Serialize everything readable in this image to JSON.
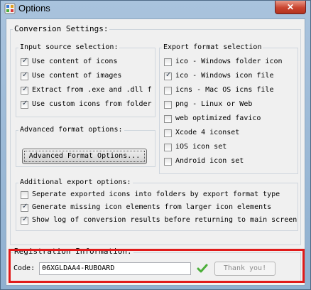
{
  "window": {
    "title": "Options",
    "close_label": "✕"
  },
  "conversion": {
    "title": "Conversion Settings:"
  },
  "input_source": {
    "title": "Input source selection:",
    "items": [
      {
        "label": "Use content of icons",
        "checked": true
      },
      {
        "label": "Use content of images",
        "checked": true
      },
      {
        "label": "Extract from .exe and .dll f",
        "checked": true
      },
      {
        "label": "Use custom icons from folder",
        "checked": true
      }
    ]
  },
  "advanced": {
    "title": "Advanced format options:",
    "button_label": "Advanced Format Options..."
  },
  "export_format": {
    "title": "Export format selection",
    "items": [
      {
        "label": "ico - Windows folder icon",
        "checked": false
      },
      {
        "label": "ico - Windows icon file",
        "checked": true
      },
      {
        "label": "icns - Mac OS icns file",
        "checked": false
      },
      {
        "label": "png - Linux or Web",
        "checked": false
      },
      {
        "label": "web optimized favico",
        "checked": false
      },
      {
        "label": "Xcode 4 iconset",
        "checked": false
      },
      {
        "label": "iOS icon set",
        "checked": false
      },
      {
        "label": "Android icon set",
        "checked": false
      }
    ]
  },
  "additional": {
    "title": "Additional export options:",
    "items": [
      {
        "label": "Seperate exported icons into folders by export format type",
        "checked": false
      },
      {
        "label": "Generate missing icon elements from larger icon elements",
        "checked": true
      },
      {
        "label": "Show log of conversion results before returning to main screen",
        "checked": true
      }
    ]
  },
  "registration": {
    "title": "Registration Information:",
    "code_label": "Code:",
    "code_value": "06XGLDAA4-RUBOARD",
    "thank_label": "Thank you!"
  },
  "colors": {
    "highlight": "#e01a1a",
    "valid_check": "#4caf3a"
  }
}
